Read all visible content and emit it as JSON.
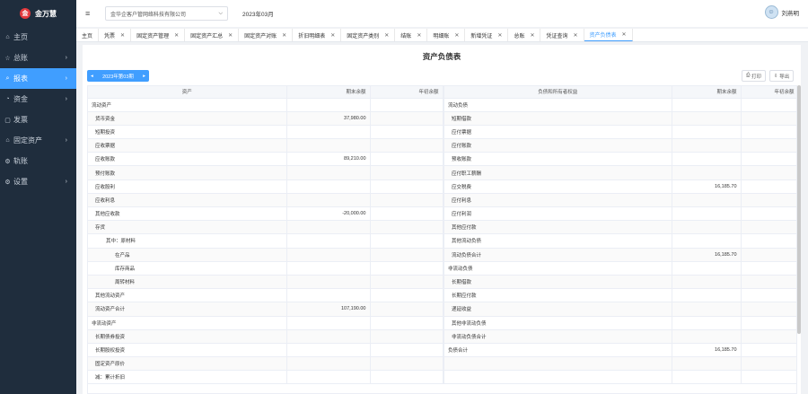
{
  "brand": {
    "logo_glyph": "金",
    "name": "金万慧"
  },
  "sidebar": {
    "items": [
      {
        "label": "主页",
        "icon": "home-icon",
        "glyph": "⌂",
        "arrow": ""
      },
      {
        "label": "总账",
        "icon": "ledger-icon",
        "glyph": "☆",
        "arrow": "›"
      },
      {
        "label": "报表",
        "icon": "search-icon",
        "glyph": "⌕",
        "arrow": "›",
        "active": true
      },
      {
        "label": "资金",
        "icon": "fund-icon",
        "glyph": "◔",
        "arrow": "›"
      },
      {
        "label": "发票",
        "icon": "invoice-icon",
        "glyph": "▢",
        "arrow": ""
      },
      {
        "label": "固定资产",
        "icon": "asset-icon",
        "glyph": "⌂",
        "arrow": "›"
      },
      {
        "label": "轨账",
        "icon": "track-icon",
        "glyph": "⚙",
        "arrow": ""
      },
      {
        "label": "设置",
        "icon": "settings-icon",
        "glyph": "⚙",
        "arrow": "›"
      }
    ]
  },
  "topbar": {
    "menu_glyph": "≡",
    "company": "金华企客户管网络科技有限公司",
    "period": "2023年03月",
    "user_glyph": "☺",
    "user_name": "刘燕明"
  },
  "tabs": [
    {
      "label": "主页",
      "closable": false
    },
    {
      "label": "凭票",
      "closable": true
    },
    {
      "label": "固定资产管理",
      "closable": true
    },
    {
      "label": "固定资产汇总",
      "closable": true
    },
    {
      "label": "固定资产对账",
      "closable": true
    },
    {
      "label": "折旧明细表",
      "closable": true
    },
    {
      "label": "固定资产类别",
      "closable": true
    },
    {
      "label": "结账",
      "closable": true
    },
    {
      "label": "明细账",
      "closable": true
    },
    {
      "label": "新增凭证",
      "closable": true
    },
    {
      "label": "总账",
      "closable": true
    },
    {
      "label": "凭证查询",
      "closable": true
    },
    {
      "label": "资产负债表",
      "closable": true,
      "active": true
    }
  ],
  "report": {
    "title": "资产负债表",
    "period_label": "2023年第03期",
    "prev_glyph": "◂",
    "next_glyph": "▸",
    "print_label": "打印",
    "print_glyph": "⎙",
    "export_label": "导出",
    "export_glyph": "⇩",
    "left_headers": [
      "资产",
      "期末余额",
      "年初余额"
    ],
    "right_headers": [
      "负债和所有者权益",
      "期末余额",
      "年初余额"
    ],
    "left_rows": [
      {
        "name": "流动资产",
        "end": "",
        "begin": "",
        "level": 0
      },
      {
        "name": "货币资金",
        "end": "37,980.00",
        "begin": "",
        "level": 1
      },
      {
        "name": "短期投资",
        "end": "",
        "begin": "",
        "level": 1
      },
      {
        "name": "应收票据",
        "end": "",
        "begin": "",
        "level": 1
      },
      {
        "name": "应收账款",
        "end": "89,210.00",
        "begin": "",
        "level": 1
      },
      {
        "name": "预付账款",
        "end": "",
        "begin": "",
        "level": 1
      },
      {
        "name": "应收股利",
        "end": "",
        "begin": "",
        "level": 1
      },
      {
        "name": "应收利息",
        "end": "",
        "begin": "",
        "level": 1
      },
      {
        "name": "其他应收款",
        "end": "-20,000.00",
        "begin": "",
        "level": 1
      },
      {
        "name": "存货",
        "end": "",
        "begin": "",
        "level": 1
      },
      {
        "name": "其中：原材料",
        "end": "",
        "begin": "",
        "level": 2
      },
      {
        "name": "在产品",
        "end": "",
        "begin": "",
        "level": 3
      },
      {
        "name": "库存商品",
        "end": "",
        "begin": "",
        "level": 3
      },
      {
        "name": "周转材料",
        "end": "",
        "begin": "",
        "level": 3
      },
      {
        "name": "其他流动资产",
        "end": "",
        "begin": "",
        "level": 1
      },
      {
        "name": "流动资产合计",
        "end": "107,190.00",
        "begin": "",
        "level": 1
      },
      {
        "name": "非流动资产",
        "end": "",
        "begin": "",
        "level": 0
      },
      {
        "name": "长期债券投资",
        "end": "",
        "begin": "",
        "level": 1
      },
      {
        "name": "长期股权投资",
        "end": "",
        "begin": "",
        "level": 1
      },
      {
        "name": "固定资产原价",
        "end": "",
        "begin": "",
        "level": 1
      },
      {
        "name": "减：累计折旧",
        "end": "",
        "begin": "",
        "level": 1
      }
    ],
    "right_rows": [
      {
        "name": "流动负债",
        "end": "",
        "begin": "",
        "level": 0
      },
      {
        "name": "短期借款",
        "end": "",
        "begin": "",
        "level": 1
      },
      {
        "name": "应付票据",
        "end": "",
        "begin": "",
        "level": 1
      },
      {
        "name": "应付账款",
        "end": "",
        "begin": "",
        "level": 1
      },
      {
        "name": "预收账款",
        "end": "",
        "begin": "",
        "level": 1
      },
      {
        "name": "应付职工薪酬",
        "end": "",
        "begin": "",
        "level": 1
      },
      {
        "name": "应交税费",
        "end": "16,185.70",
        "begin": "",
        "level": 1
      },
      {
        "name": "应付利息",
        "end": "",
        "begin": "",
        "level": 1
      },
      {
        "name": "应付利润",
        "end": "",
        "begin": "",
        "level": 1
      },
      {
        "name": "其他应付款",
        "end": "",
        "begin": "",
        "level": 1
      },
      {
        "name": "其他流动负债",
        "end": "",
        "begin": "",
        "level": 1
      },
      {
        "name": "流动负债合计",
        "end": "16,185.70",
        "begin": "",
        "level": 1
      },
      {
        "name": "非流动负债",
        "end": "",
        "begin": "",
        "level": 0
      },
      {
        "name": "长期借款",
        "end": "",
        "begin": "",
        "level": 1
      },
      {
        "name": "长期应付款",
        "end": "",
        "begin": "",
        "level": 1
      },
      {
        "name": "递延收益",
        "end": "",
        "begin": "",
        "level": 1
      },
      {
        "name": "其他非流动负债",
        "end": "",
        "begin": "",
        "level": 1
      },
      {
        "name": "非流动负债合计",
        "end": "",
        "begin": "",
        "level": 1
      },
      {
        "name": "负债合计",
        "end": "16,185.70",
        "begin": "",
        "level": 0
      },
      {
        "name": "",
        "end": "",
        "begin": "",
        "level": 1
      },
      {
        "name": "",
        "end": "",
        "begin": "",
        "level": 1
      }
    ]
  }
}
